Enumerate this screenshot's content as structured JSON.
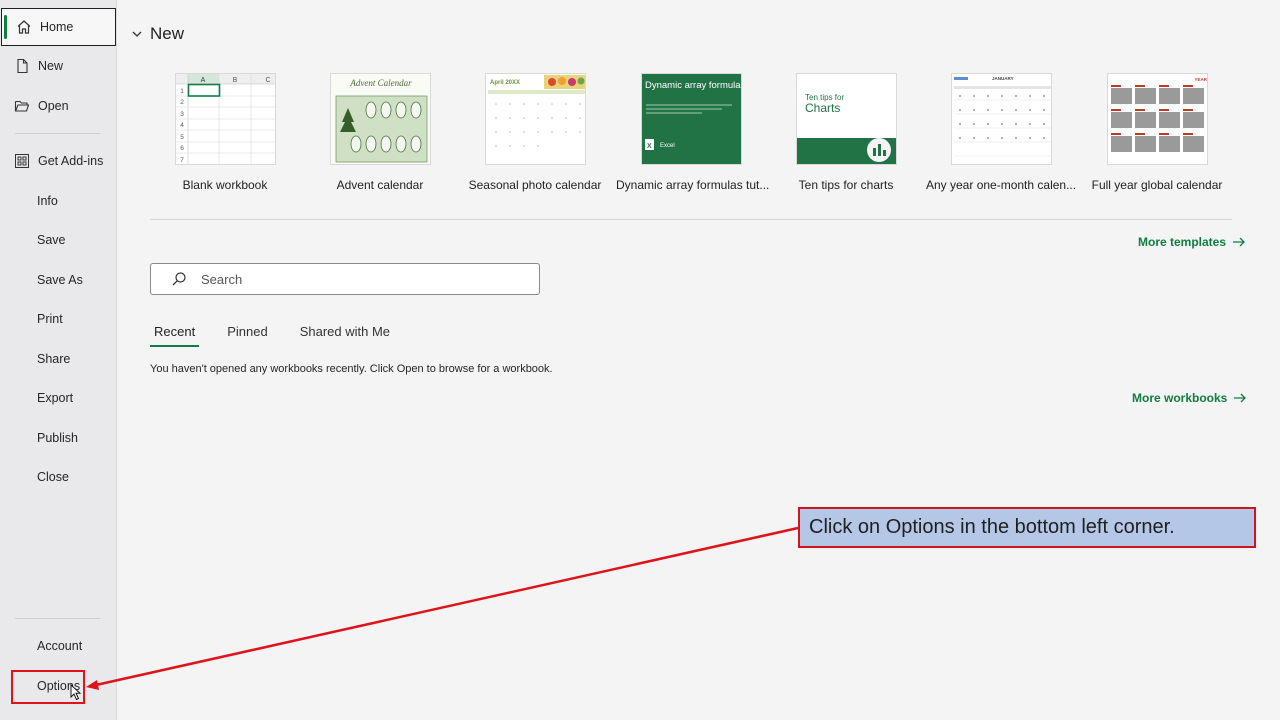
{
  "sidebar": {
    "items": [
      {
        "label": "Home",
        "icon": "home-icon"
      },
      {
        "label": "New",
        "icon": "new-document-icon"
      },
      {
        "label": "Open",
        "icon": "folder-open-icon"
      },
      {
        "label": "Get Add-ins",
        "icon": "add-ins-grid-icon"
      },
      {
        "label": "Info"
      },
      {
        "label": "Save"
      },
      {
        "label": "Save As"
      },
      {
        "label": "Print"
      },
      {
        "label": "Share"
      },
      {
        "label": "Export"
      },
      {
        "label": "Publish"
      },
      {
        "label": "Close"
      },
      {
        "label": "Account"
      },
      {
        "label": "Options"
      }
    ]
  },
  "new_section": {
    "title": "New",
    "templates": [
      {
        "name": "Blank workbook"
      },
      {
        "name": "Advent calendar",
        "thumb_title": "Advent Calendar"
      },
      {
        "name": "Seasonal photo calendar",
        "thumb_title": "April 20XX"
      },
      {
        "name": "Dynamic array formulas tut...",
        "thumb_title": "Dynamic array formulas",
        "thumb_app": "Excel"
      },
      {
        "name": "Ten tips for charts",
        "thumb_line1": "Ten tips for",
        "thumb_line2": "Charts"
      },
      {
        "name": "Any year one-month calen...",
        "thumb_title": "JANUARY"
      },
      {
        "name": "Full year global calendar",
        "thumb_title": "YEAR"
      }
    ],
    "blank_columns": [
      "A",
      "B",
      "C"
    ],
    "blank_rows": [
      "1",
      "2",
      "3",
      "4",
      "5",
      "6",
      "7"
    ],
    "more_templates": "More templates"
  },
  "search": {
    "placeholder": "Search"
  },
  "tabs": [
    {
      "label": "Recent",
      "active": true
    },
    {
      "label": "Pinned",
      "active": false
    },
    {
      "label": "Shared with Me",
      "active": false
    }
  ],
  "recent": {
    "empty_message": "You haven't opened any workbooks recently. Click Open to browse for a workbook.",
    "more_workbooks": "More workbooks"
  },
  "annotation": {
    "callout_text": "Click on Options in the bottom left corner.",
    "callout_bg": "#b4c7e7",
    "callout_border": "#d0141c"
  },
  "colors": {
    "accent": "#107c41",
    "annotation_red": "#e0131b"
  }
}
